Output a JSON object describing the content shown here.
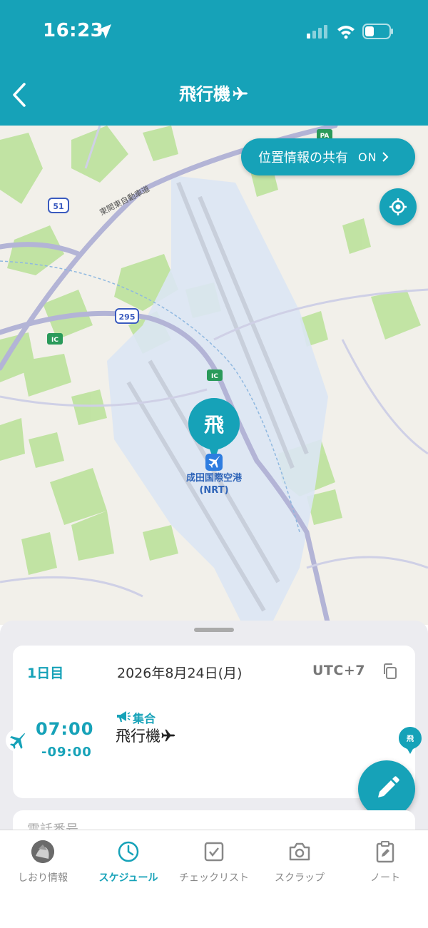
{
  "status_bar": {
    "time": "16:23"
  },
  "header": {
    "title": "飛行機",
    "back_icon": "chevron-left-icon",
    "title_icon": "airplane-icon"
  },
  "map": {
    "share_location": {
      "label": "位置情報の共有",
      "state": "ON"
    },
    "pin_label": "飛",
    "airport_name": "成田国際空港",
    "airport_code": "(NRT)",
    "road_labels": {
      "route_51": "51",
      "route_295": "295",
      "ic_1": "IC",
      "ic_2": "IC",
      "pa": "PA",
      "expressway": "東関東自動車道"
    }
  },
  "schedule": {
    "day": "1日目",
    "date": "2026年8月24日(月)",
    "timezone": "UTC+7",
    "event": {
      "start": "07:00",
      "end": "-09:00",
      "category": "集合",
      "title": "飛行機",
      "pin_label": "飛"
    },
    "next_card_label": "電話番号"
  },
  "tabs": [
    {
      "id": "info",
      "label": "しおり情報",
      "icon": "avatar-icon",
      "active": false
    },
    {
      "id": "schedule",
      "label": "スケジュール",
      "icon": "clock-icon",
      "active": true
    },
    {
      "id": "checklist",
      "label": "チェックリスト",
      "icon": "checkbox-icon",
      "active": false
    },
    {
      "id": "scrap",
      "label": "スクラップ",
      "icon": "camera-icon",
      "active": false
    },
    {
      "id": "note",
      "label": "ノート",
      "icon": "clipboard-edit-icon",
      "active": false
    }
  ],
  "colors": {
    "accent": "#16a2b8",
    "map_bg": "#f2f0ea",
    "airport_area": "#dce6f4",
    "park": "#bfe3a0",
    "road": "#b3b4d6"
  }
}
